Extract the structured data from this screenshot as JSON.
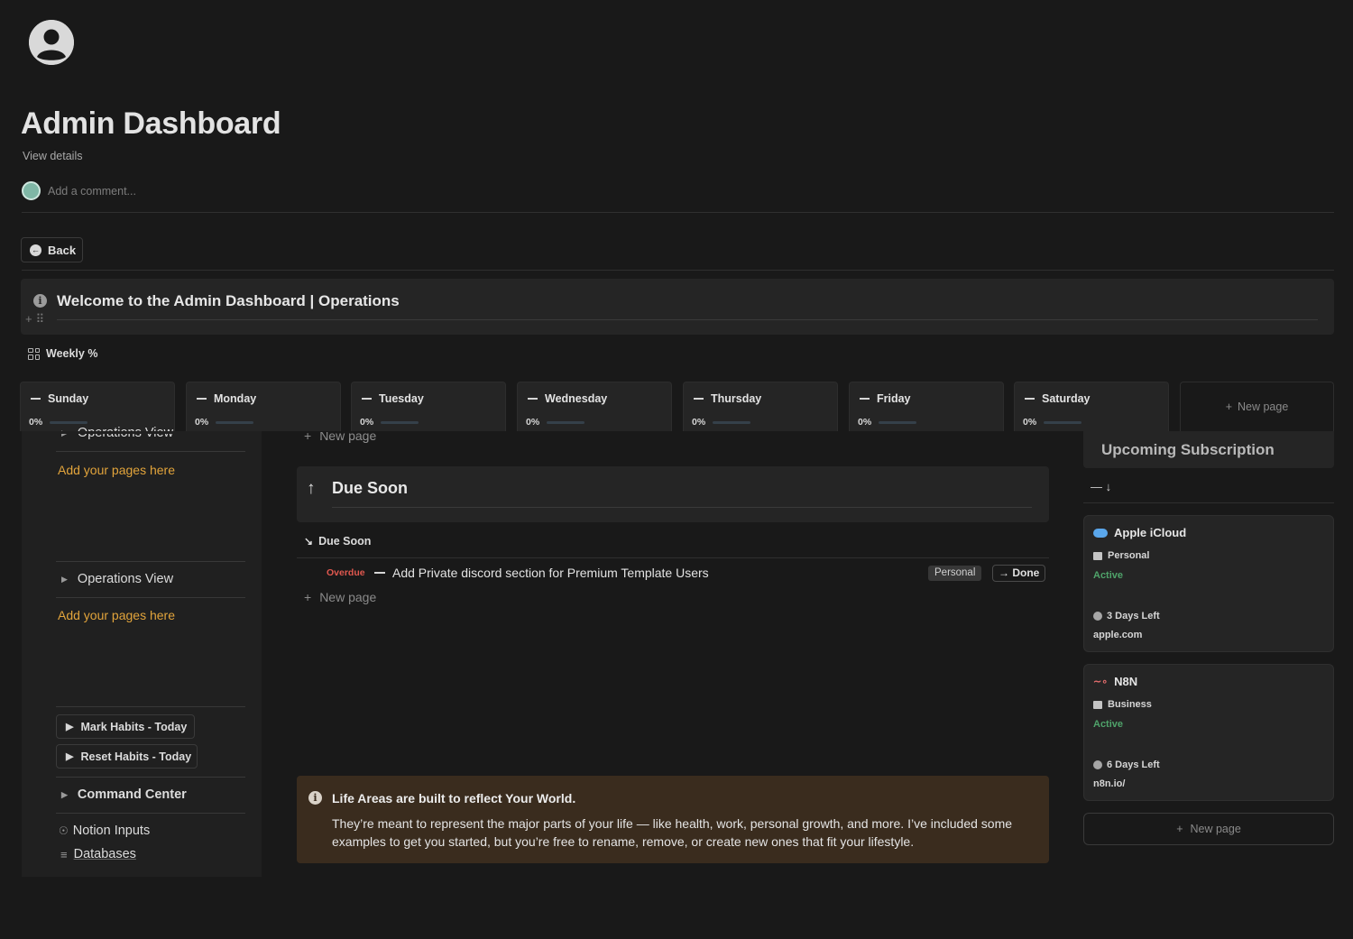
{
  "page": {
    "title": "Admin Dashboard",
    "view_details": "View details",
    "comment_placeholder": "Add a comment...",
    "back_label": "Back",
    "icons": {
      "page": "user-circle-icon",
      "back": "arrow-left-circle-icon",
      "info": "info-icon"
    }
  },
  "welcome_callout": {
    "title": "Welcome to the Admin Dashboard | Operations"
  },
  "weekly": {
    "view_label": "Weekly %",
    "days": [
      {
        "name": "Sunday",
        "percent": "0%",
        "progress": 0
      },
      {
        "name": "Monday",
        "percent": "0%",
        "progress": 0
      },
      {
        "name": "Tuesday",
        "percent": "0%",
        "progress": 0
      },
      {
        "name": "Wednesday",
        "percent": "0%",
        "progress": 0
      },
      {
        "name": "Thursday",
        "percent": "0%",
        "progress": 0
      },
      {
        "name": "Friday",
        "percent": "0%",
        "progress": 0
      },
      {
        "name": "Saturday",
        "percent": "0%",
        "progress": 0
      }
    ],
    "new_page": "New page"
  },
  "sidebar": {
    "toggle_1": "Operations View",
    "add_pages_1": "Add your pages here",
    "toggle_2": "Operations View",
    "add_pages_2": "Add your pages here",
    "mark_habits": "Mark Habits - Today",
    "reset_habits": "Reset Habits - Today",
    "command_center": "Command Center",
    "notion_inputs": "Notion Inputs",
    "databases": "Databases"
  },
  "main": {
    "new_page_top": "New page",
    "due_soon_heading": "Due Soon",
    "due_soon_view": "Due Soon",
    "task": {
      "status": "Overdue",
      "title": "Add Private discord section for Premium Template Users",
      "tag": "Personal",
      "action": "Done"
    },
    "new_page_bottom": "New page",
    "life_callout": {
      "title": "Life Areas are built to reflect Your World.",
      "body": "They’re meant to represent the major parts of your life — like health, work, personal growth, and more. I’ve included some examples to get you started, but you’re free to rename, remove, or create new ones that fit your lifestyle."
    }
  },
  "subscriptions": {
    "title": "Upcoming Subscription",
    "sort_indicator": "— ↓",
    "items": [
      {
        "name": "Apple iCloud",
        "type": "Personal",
        "status": "Active",
        "days_left": "3 Days Left",
        "url": "apple.com",
        "icon": "cloud-icon"
      },
      {
        "name": "N8N",
        "type": "Business",
        "status": "Active",
        "days_left": "6 Days Left",
        "url": "n8n.io/",
        "icon": "n8n-icon"
      }
    ],
    "new_page": "New page"
  },
  "colors": {
    "background": "#191919",
    "accent_orange": "#e2a43b",
    "overdue_red": "#e0584f",
    "active_green": "#4fa36a",
    "callout_brown": "#3a2c1e"
  }
}
